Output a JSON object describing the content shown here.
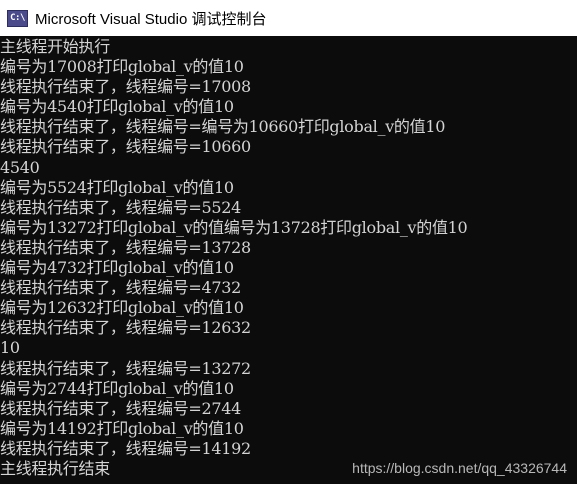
{
  "window": {
    "title": "Microsoft Visual Studio 调试控制台",
    "icon": "console-app-icon",
    "icon_text": "C:\\"
  },
  "console": {
    "lines": [
      "主线程开始执行",
      "编号为17008打印global_v的值10",
      "线程执行结束了，线程编号=17008",
      "编号为4540打印global_v的值10",
      "线程执行结束了，线程编号=编号为10660打印global_v的值10",
      "线程执行结束了，线程编号=10660",
      "4540",
      "编号为5524打印global_v的值10",
      "线程执行结束了，线程编号=5524",
      "编号为13272打印global_v的值编号为13728打印global_v的值10",
      "线程执行结束了，线程编号=13728",
      "编号为4732打印global_v的值10",
      "线程执行结束了，线程编号=4732",
      "编号为12632打印global_v的值10",
      "线程执行结束了，线程编号=12632",
      "10",
      "线程执行结束了，线程编号=13272",
      "编号为2744打印global_v的值10",
      "线程执行结束了，线程编号=2744",
      "编号为14192打印global_v的值10",
      "线程执行结束了，线程编号=14192",
      "主线程执行结束"
    ]
  },
  "watermark": "https://blog.csdn.net/qq_43326744",
  "colors": {
    "console_bg": "#0c0c0c",
    "console_text": "#d4d4d4",
    "titlebar_bg": "#ffffff",
    "title_text": "#000000"
  }
}
